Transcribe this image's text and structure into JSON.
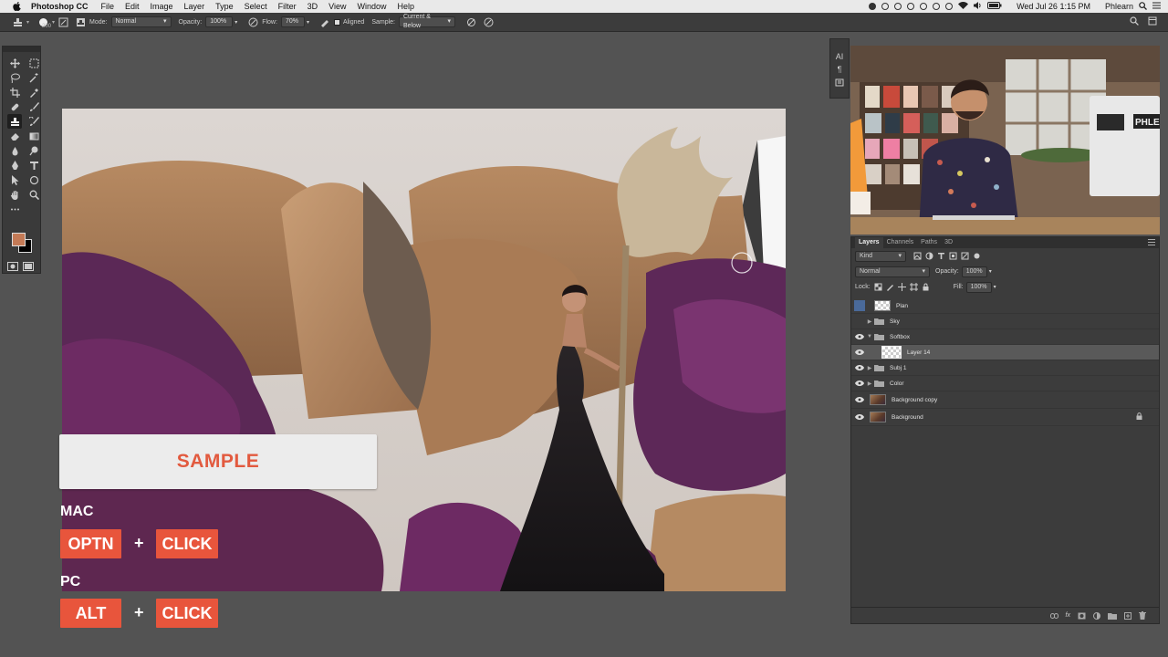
{
  "menubar": {
    "app_name": "Photoshop CC",
    "items": [
      "File",
      "Edit",
      "Image",
      "Layer",
      "Type",
      "Select",
      "Filter",
      "3D",
      "View",
      "Window",
      "Help"
    ],
    "clock": "Wed Jul 26  1:15 PM",
    "user": "Phlearn"
  },
  "options": {
    "brush_size": "200",
    "mode_label": "Mode:",
    "mode_value": "Normal",
    "opacity_label": "Opacity:",
    "opacity_value": "100%",
    "flow_label": "Flow:",
    "flow_value": "70%",
    "aligned_label": "Aligned",
    "sample_label": "Sample:",
    "sample_value": "Current & Below"
  },
  "overlay": {
    "sample_title": "SAMPLE",
    "mac_label": "MAC",
    "pc_label": "PC",
    "mac_key1": "OPTN",
    "mac_key2": "CLICK",
    "pc_key1": "ALT",
    "pc_key2": "CLICK",
    "plus": "+"
  },
  "panel_strip": [
    "AI",
    "¶"
  ],
  "video": {
    "sign_text": "PHLEA"
  },
  "layers_panel": {
    "tabs": [
      "Layers",
      "Channels",
      "Paths",
      "3D"
    ],
    "filter_kind": "Kind",
    "blend_mode": "Normal",
    "opacity_label": "Opacity:",
    "opacity_value": "100%",
    "lock_label": "Lock:",
    "fill_label": "Fill:",
    "fill_value": "100%",
    "layers": [
      {
        "name": "Plan",
        "type": "layer",
        "visible": false,
        "thumb": "checker"
      },
      {
        "name": "Sky",
        "type": "group",
        "visible": false
      },
      {
        "name": "Softbox",
        "type": "group-open",
        "visible": true
      },
      {
        "name": "Layer 14",
        "type": "layer",
        "visible": true,
        "thumb": "checker",
        "selected": true
      },
      {
        "name": "Subj 1",
        "type": "group",
        "visible": true
      },
      {
        "name": "Color",
        "type": "group",
        "visible": true
      },
      {
        "name": "Background copy",
        "type": "layer",
        "visible": true,
        "thumb": "photo"
      },
      {
        "name": "Background",
        "type": "layer",
        "visible": true,
        "thumb": "photo",
        "locked": true
      }
    ]
  },
  "colors": {
    "foreground": "#c47a56",
    "background": "#000000",
    "accent": "#e8553c"
  }
}
